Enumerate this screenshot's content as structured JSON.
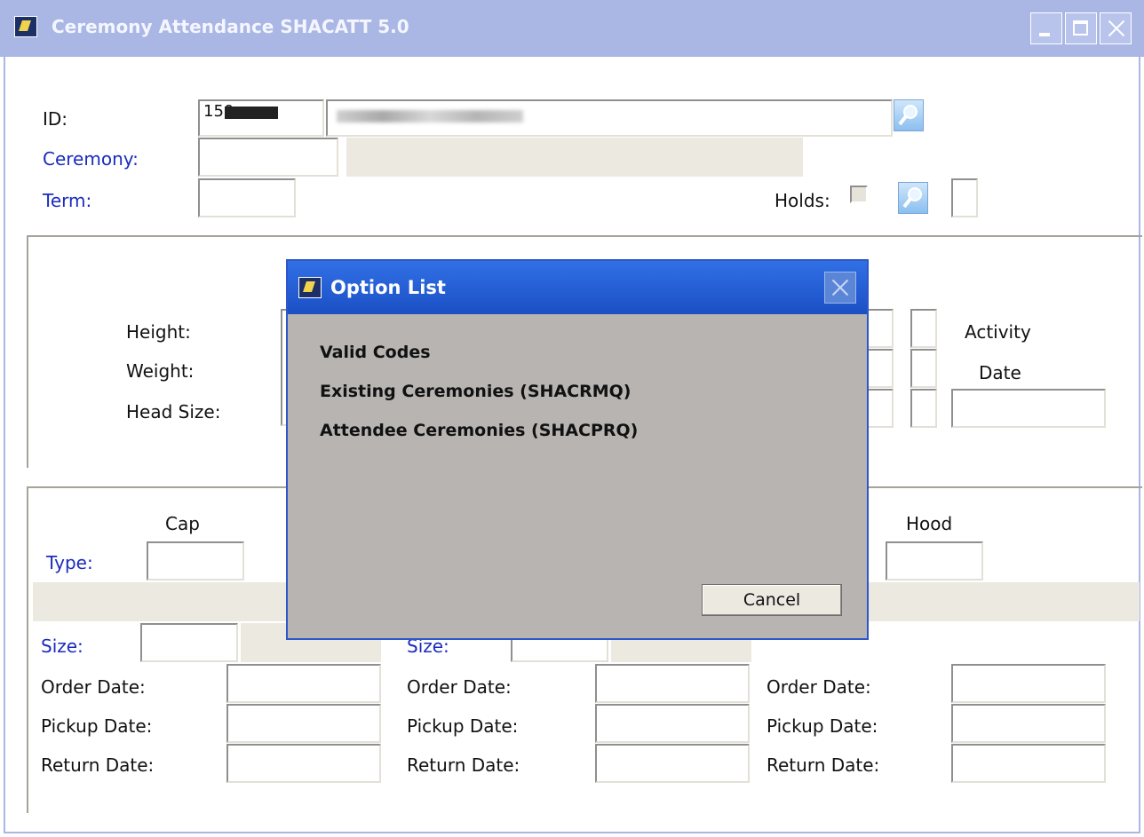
{
  "window": {
    "title": "Ceremony Attendance  SHACATT  5.0"
  },
  "header": {
    "id_label": "ID:",
    "id_value": "150",
    "ceremony_label": "Ceremony:",
    "term_label": "Term:",
    "holds_label": "Holds:"
  },
  "measurements": {
    "height_label": "Height:",
    "weight_label": "Weight:",
    "head_size_label": "Head Size:",
    "activity_label": "Activity",
    "date_label": "Date"
  },
  "regalia": {
    "cap_header": "Cap",
    "hood_header": "Hood",
    "type_label": "Type:",
    "size_label": "Size:",
    "size_label_2": "Size:",
    "order_date_label": "Order Date:",
    "pickup_date_label": "Pickup Date:",
    "return_date_label": "Return Date:"
  },
  "dialog": {
    "title": "Option List",
    "options": [
      "Valid Codes",
      "Existing Ceremonies (SHACRMQ)",
      "Attendee Ceremonies (SHACPRQ)"
    ],
    "cancel_label": "Cancel"
  },
  "colors": {
    "link_label": "#1b2bbf",
    "dialog_title_bar": "#1b4fc4",
    "window_title_bar_inactive": "#aab6e4"
  }
}
